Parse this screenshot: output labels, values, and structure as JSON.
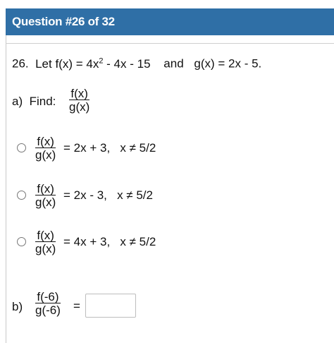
{
  "header": {
    "title": "Question #26 of 32"
  },
  "problem": {
    "number": "26.",
    "statement_f": "Let f(x) = 4x",
    "exponent": "2",
    "statement_f_tail": " - 4x - 15",
    "and": "and",
    "statement_g": "g(x) = 2x - 5."
  },
  "part_a": {
    "label": "a)",
    "find": "Find:",
    "numerator": "f(x)",
    "denominator": "g(x)",
    "choices": [
      {
        "numerator": "f(x)",
        "denominator": "g(x)",
        "rhs": "= 2x + 3,",
        "cond": "x ≠ 5/2"
      },
      {
        "numerator": "f(x)",
        "denominator": "g(x)",
        "rhs": "= 2x - 3,",
        "cond": "x ≠ 5/2"
      },
      {
        "numerator": "f(x)",
        "denominator": "g(x)",
        "rhs": "= 4x + 3,",
        "cond": "x ≠ 5/2"
      }
    ]
  },
  "part_b": {
    "label": "b)",
    "numerator": "f(-6)",
    "denominator": "g(-6)",
    "equals": "=",
    "answer_value": ""
  }
}
